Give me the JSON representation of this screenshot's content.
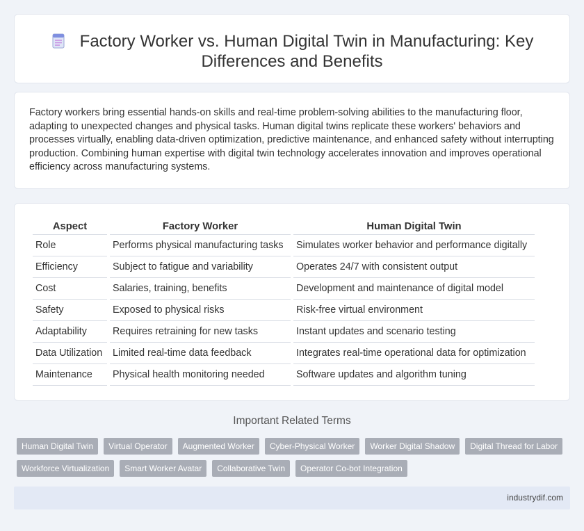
{
  "header": {
    "title": "Factory Worker vs. Human Digital Twin in Manufacturing: Key Differences and Benefits"
  },
  "summary": "Factory workers bring essential hands-on skills and real-time problem-solving abilities to the manufacturing floor, adapting to unexpected changes and physical tasks. Human digital twins replicate these workers' behaviors and processes virtually, enabling data-driven optimization, predictive maintenance, and enhanced safety without interrupting production. Combining human expertise with digital twin technology accelerates innovation and improves operational efficiency across manufacturing systems.",
  "table": {
    "headers": [
      "Aspect",
      "Factory Worker",
      "Human Digital Twin"
    ],
    "rows": [
      [
        "Role",
        "Performs physical manufacturing tasks",
        "Simulates worker behavior and performance digitally"
      ],
      [
        "Efficiency",
        "Subject to fatigue and variability",
        "Operates 24/7 with consistent output"
      ],
      [
        "Cost",
        "Salaries, training, benefits",
        "Development and maintenance of digital model"
      ],
      [
        "Safety",
        "Exposed to physical risks",
        "Risk-free virtual environment"
      ],
      [
        "Adaptability",
        "Requires retraining for new tasks",
        "Instant updates and scenario testing"
      ],
      [
        "Data Utilization",
        "Limited real-time data feedback",
        "Integrates real-time operational data for optimization"
      ],
      [
        "Maintenance",
        "Physical health monitoring needed",
        "Software updates and algorithm tuning"
      ]
    ]
  },
  "related": {
    "heading": "Important Related Terms",
    "tags": [
      "Human Digital Twin",
      "Virtual Operator",
      "Augmented Worker",
      "Cyber-Physical Worker",
      "Worker Digital Shadow",
      "Digital Thread for Labor",
      "Workforce Virtualization",
      "Smart Worker Avatar",
      "Collaborative Twin",
      "Operator Co-bot Integration"
    ]
  },
  "footer": {
    "site": "industrydif.com"
  },
  "icons": {
    "title_icon": "document-icon"
  }
}
